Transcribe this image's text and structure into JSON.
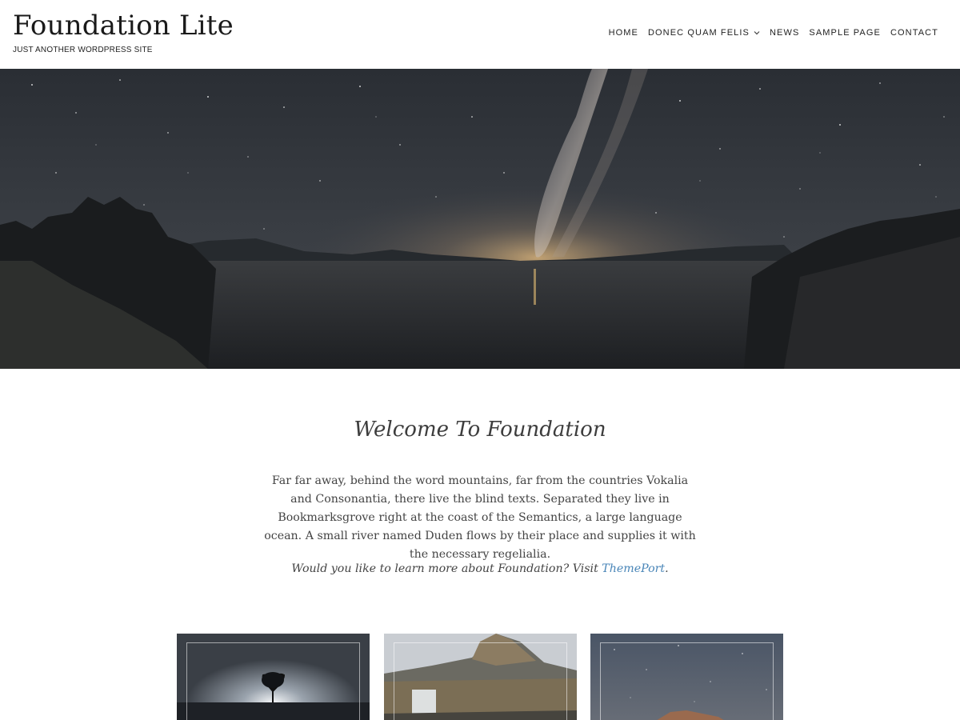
{
  "site": {
    "title": "Foundation Lite",
    "description": "JUST ANOTHER WORDPRESS SITE"
  },
  "nav": {
    "items": [
      {
        "label": "HOME",
        "has_dropdown": false
      },
      {
        "label": "DONEC QUAM FELIS",
        "has_dropdown": true
      },
      {
        "label": "NEWS",
        "has_dropdown": false
      },
      {
        "label": "SAMPLE PAGE",
        "has_dropdown": false
      },
      {
        "label": "CONTACT",
        "has_dropdown": false
      }
    ],
    "dropdown_icon": "chevron-down-icon"
  },
  "hero": {
    "image": "night-sky-milky-way-over-lake"
  },
  "welcome": {
    "title": "Welcome To Foundation",
    "body": "Far far away, behind the word mountains, far from the countries Vokalia and Consonantia, there live the blind texts. Separated they live in Bookmarksgrove right at the coast of the Semantics, a large language ocean. A small river named Duden flows by their place and supplies it with the necessary regelialia.",
    "cta_prefix": "Would you like to learn more about Foundation? Visit ",
    "cta_link": "ThemePort",
    "cta_suffix": "."
  },
  "cards": [
    {
      "image": "lone-tree-reflection-image"
    },
    {
      "image": "mountain-waterfall-image"
    },
    {
      "image": "starry-sky-rocks-image"
    }
  ],
  "colors": {
    "link": "#4a86b8",
    "text": "#444444",
    "title": "#1a1a1a"
  }
}
